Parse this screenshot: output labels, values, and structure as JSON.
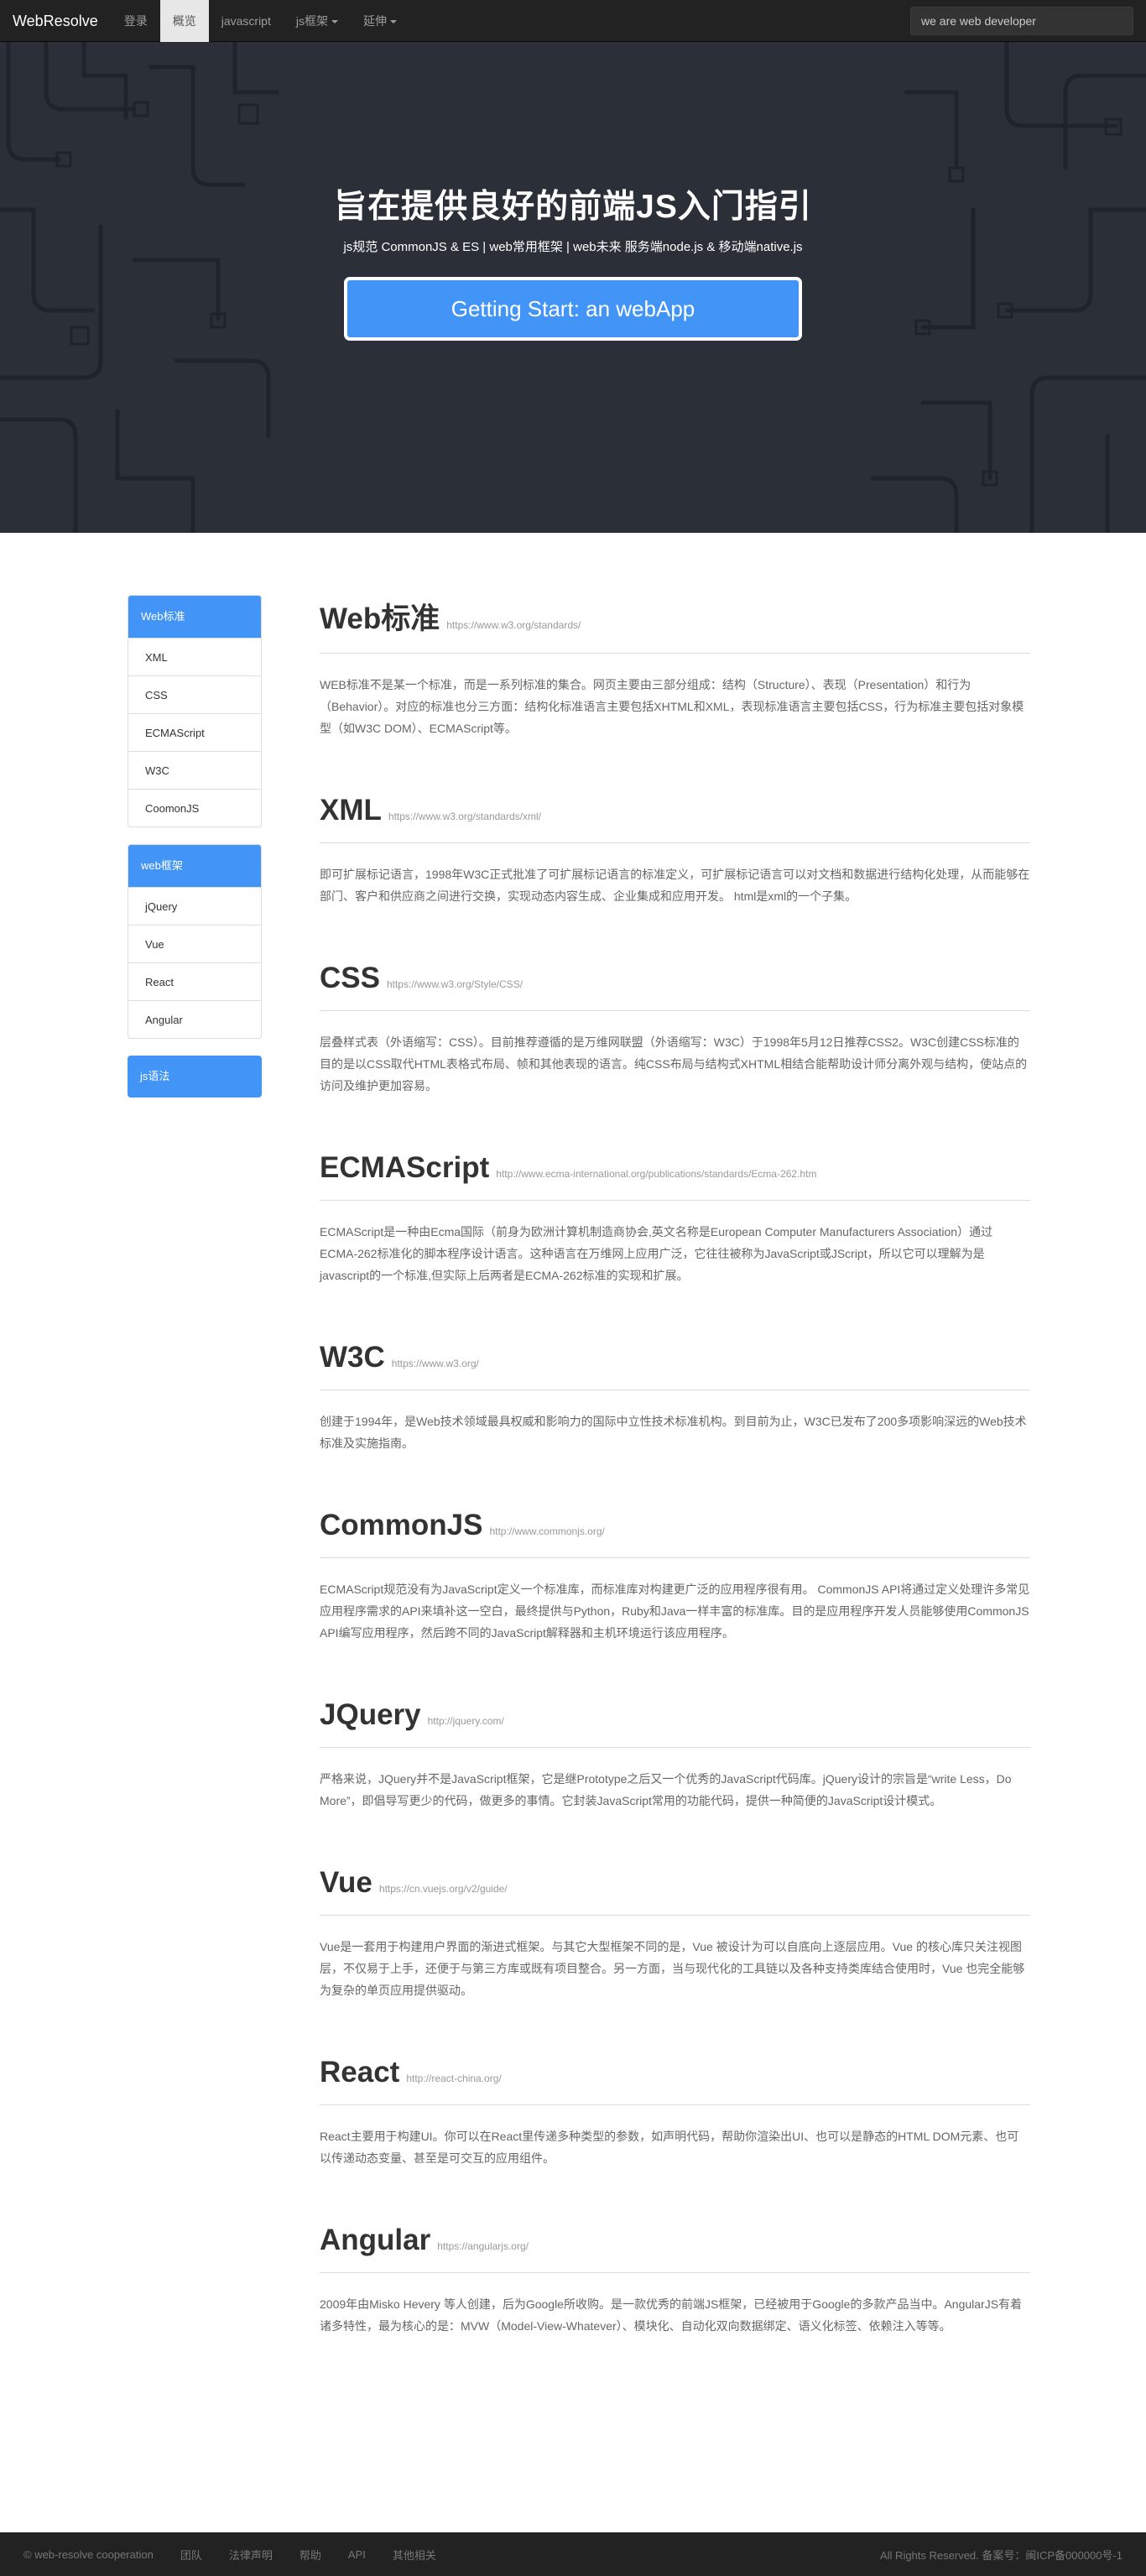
{
  "navbar": {
    "brand": "WebResolve",
    "items": [
      {
        "label": "登录"
      },
      {
        "label": "概览"
      },
      {
        "label": "javascript"
      },
      {
        "label": "js框架"
      },
      {
        "label": "延伸"
      }
    ],
    "search_placeholder": "we are web developer"
  },
  "hero": {
    "title": "旨在提供良好的前端JS入门指引",
    "subtitle": "js规范 CommonJS & ES | web常用框架 | web未来 服务端node.js & 移动端native.js",
    "cta_label": "Getting Start: an webApp"
  },
  "sidebar": {
    "groups": [
      {
        "title": "Web标准",
        "items": [
          "XML",
          "CSS",
          "ECMAScript",
          "W3C",
          "CoomonJS"
        ]
      },
      {
        "title": "web框架",
        "items": [
          "jQuery",
          "Vue",
          "React",
          "Angular"
        ]
      },
      {
        "title": "js语法",
        "items": []
      }
    ]
  },
  "sections": [
    {
      "title": "Web标准",
      "link": "https://www.w3.org/standards/",
      "body": "WEB标准不是某一个标准，而是一系列标准的集合。网页主要由三部分组成：结构（Structure）、表现（Presentation）和行为（Behavior）。对应的标准也分三方面：结构化标准语言主要包括XHTML和XML，表现标准语言主要包括CSS，行为标准主要包括对象模型（如W3C DOM）、ECMAScript等。"
    },
    {
      "title": "XML",
      "link": "https://www.w3.org/standards/xml/",
      "body": "即可扩展标记语言，1998年W3C正式批准了可扩展标记语言的标准定义，可扩展标记语言可以对文档和数据进行结构化处理，从而能够在部门、客户和供应商之间进行交换，实现动态内容生成、企业集成和应用开发。 html是xml的一个子集。"
    },
    {
      "title": "CSS",
      "link": "https://www.w3.org/Style/CSS/",
      "body": "层叠样式表（外语缩写：CSS）。目前推荐遵循的是万维网联盟（外语缩写：W3C）于1998年5月12日推荐CSS2。W3C创建CSS标准的目的是以CSS取代HTML表格式布局、帧和其他表现的语言。纯CSS布局与结构式XHTML相结合能帮助设计师分离外观与结构，使站点的访问及维护更加容易。"
    },
    {
      "title": "ECMAScript",
      "link": "http://www.ecma-international.org/publications/standards/Ecma-262.htm",
      "body": "ECMAScript是一种由Ecma国际（前身为欧洲计算机制造商协会,英文名称是European Computer Manufacturers Association）通过ECMA-262标准化的脚本程序设计语言。这种语言在万维网上应用广泛，它往往被称为JavaScript或JScript，所以它可以理解为是javascript的一个标准,但实际上后两者是ECMA-262标准的实现和扩展。"
    },
    {
      "title": "W3C",
      "link": "https://www.w3.org/",
      "body": "创建于1994年，是Web技术领域最具权威和影响力的国际中立性技术标准机构。到目前为止，W3C已发布了200多项影响深远的Web技术标准及实施指南。"
    },
    {
      "title": "CommonJS",
      "link": "http://www.commonjs.org/",
      "body": "ECMAScript规范没有为JavaScript定义一个标准库，而标准库对构建更广泛的应用程序很有用。 CommonJS API将通过定义处理许多常见应用程序需求的API来填补这一空白，最终提供与Python，Ruby和Java一样丰富的标准库。目的是应用程序开发人员能够使用CommonJS API编写应用程序，然后跨不同的JavaScript解释器和主机环境运行该应用程序。"
    },
    {
      "title": "JQuery",
      "link": "http://jquery.com/",
      "body": "严格来说，JQuery并不是JavaScript框架，它是继Prototype之后又一个优秀的JavaScript代码库。jQuery设计的宗旨是“write Less，Do More”，即倡导写更少的代码，做更多的事情。它封装JavaScript常用的功能代码，提供一种简便的JavaScript设计模式。"
    },
    {
      "title": "Vue",
      "link": "https://cn.vuejs.org/v2/guide/",
      "body": "Vue是一套用于构建用户界面的渐进式框架。与其它大型框架不同的是，Vue 被设计为可以自底向上逐层应用。Vue 的核心库只关注视图层，不仅易于上手，还便于与第三方库或既有项目整合。另一方面，当与现代化的工具链以及各种支持类库结合使用时，Vue 也完全能够为复杂的单页应用提供驱动。"
    },
    {
      "title": "React",
      "link": "http://react-china.org/",
      "body": "React主要用于构建UI。你可以在React里传递多种类型的参数，如声明代码，帮助你渲染出UI、也可以是静态的HTML DOM元素、也可以传递动态变量、甚至是可交互的应用组件。"
    },
    {
      "title": "Angular",
      "link": "https://angularjs.org/",
      "body": "2009年由Misko Hevery 等人创建，后为Google所收购。是一款优秀的前端JS框架，已经被用于Google的多款产品当中。AngularJS有着诸多特性，最为核心的是：MVW（Model-View-Whatever）、模块化、自动化双向数据绑定、语义化标签、依赖注入等等。"
    }
  ],
  "footer": {
    "copyright": "© web-resolve cooperation",
    "links": [
      "团队",
      "法律声明",
      "帮助",
      "API",
      "其他相关"
    ],
    "rights": "All Rights Reserved. 备案号：闽ICP备000000号-1"
  }
}
